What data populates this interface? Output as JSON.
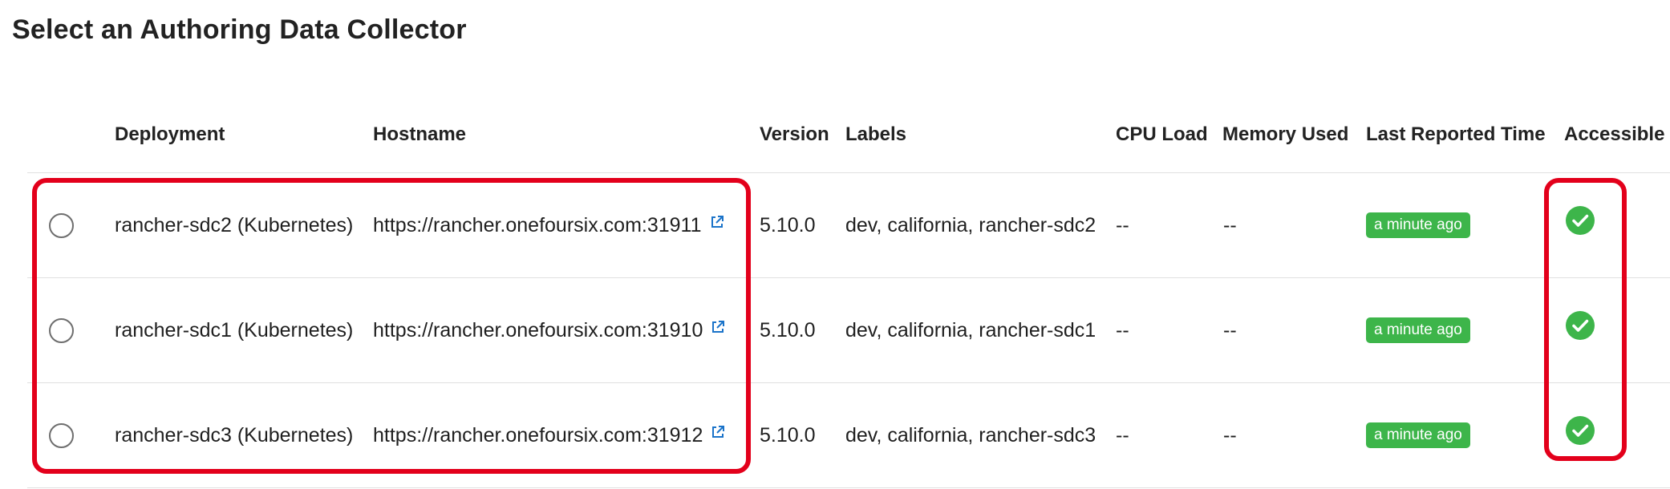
{
  "page": {
    "title": "Select an Authoring Data Collector"
  },
  "table": {
    "columns": {
      "deployment": "Deployment",
      "hostname": "Hostname",
      "version": "Version",
      "labels": "Labels",
      "cpu_load": "CPU Load",
      "memory_used": "Memory Used",
      "last_reported_time": "Last Reported Time",
      "accessible": "Accessible"
    },
    "rows": [
      {
        "deployment": "rancher-sdc2 (Kubernetes)",
        "hostname": "https://rancher.onefoursix.com:31911",
        "version": "5.10.0",
        "labels": "dev, california, rancher-sdc2",
        "cpu_load": "--",
        "memory_used": "--",
        "last_reported": "a minute ago",
        "accessible_icon": "check-circle-icon"
      },
      {
        "deployment": "rancher-sdc1 (Kubernetes)",
        "hostname": "https://rancher.onefoursix.com:31910",
        "version": "5.10.0",
        "labels": "dev, california, rancher-sdc1",
        "cpu_load": "--",
        "memory_used": "--",
        "last_reported": "a minute ago",
        "accessible_icon": "check-circle-icon"
      },
      {
        "deployment": "rancher-sdc3 (Kubernetes)",
        "hostname": "https://rancher.onefoursix.com:31912",
        "version": "5.10.0",
        "labels": "dev, california, rancher-sdc3",
        "cpu_load": "--",
        "memory_used": "--",
        "last_reported": "a minute ago",
        "accessible_icon": "check-circle-icon"
      }
    ]
  },
  "colors": {
    "badge": "#3db54a",
    "check": "#3db54a",
    "highlight": "#e3001b",
    "link_icon": "#1a73c9"
  }
}
